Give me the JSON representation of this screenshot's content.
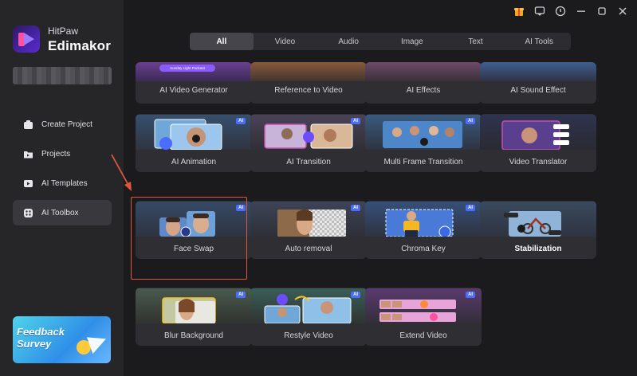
{
  "sidebar": {
    "brand_line1": "HitPaw",
    "brand_line2": "Edimakor",
    "nav": [
      {
        "label": "Create Project",
        "icon": "create-project-icon"
      },
      {
        "label": "Projects",
        "icon": "projects-icon"
      },
      {
        "label": "AI Templates",
        "icon": "ai-templates-icon"
      },
      {
        "label": "AI Toolbox",
        "icon": "ai-toolbox-icon",
        "active": true
      }
    ],
    "feedback_line1": "Feedback",
    "feedback_line2": "Survey"
  },
  "titlebar": {
    "icons": [
      "gift-icon",
      "message-icon",
      "info-icon",
      "minimize-icon",
      "maximize-icon",
      "close-icon"
    ]
  },
  "tabs": [
    {
      "label": "All",
      "active": true
    },
    {
      "label": "Video"
    },
    {
      "label": "Audio"
    },
    {
      "label": "Image"
    },
    {
      "label": "Text"
    },
    {
      "label": "AI Tools"
    }
  ],
  "badge": "AI",
  "cards": {
    "row0": [
      "AI Video Generator",
      "Reference to Video",
      "AI Effects",
      "AI Sound Effect"
    ],
    "row0_pill": "Sunday Light Podcast",
    "row1": [
      "AI Animation",
      "AI Transition",
      "Multi Frame Transition",
      "Video Translator"
    ],
    "row2": [
      "Face Swap",
      "Auto removal",
      "Chroma Key",
      "Stabilization"
    ],
    "row3": [
      "Blur Background",
      "Restyle Video",
      "Extend Video"
    ]
  },
  "colors": {
    "accent": "#4a6cff",
    "highlight": "#e2553e",
    "sidebar_bg": "#262629",
    "content_bg": "#1b1b1e"
  }
}
